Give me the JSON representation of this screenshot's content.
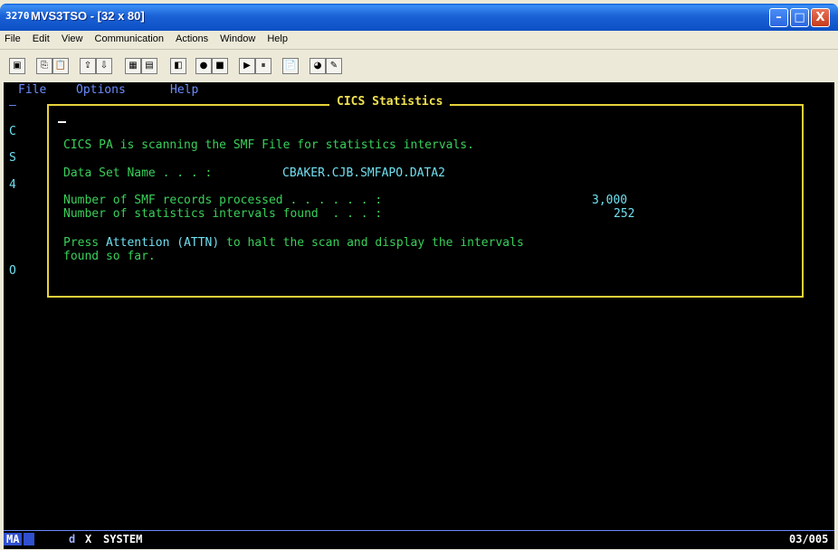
{
  "window": {
    "icon": "3270",
    "title": "MVS3TSO - [32 x 80]",
    "min": "–",
    "max": "□",
    "close": "X"
  },
  "menubar": [
    "File",
    "Edit",
    "View",
    "Communication",
    "Actions",
    "Window",
    "Help"
  ],
  "terminal": {
    "menu": {
      "file": "File",
      "options": "Options",
      "help": "Help"
    },
    "side_letters": [
      "C",
      "S",
      "4",
      "O"
    ],
    "panel_title": "CICS Statistics",
    "line1": "CICS PA is scanning the SMF File for statistics intervals.",
    "dsn_label": "Data Set Name . . . :",
    "dsn_value": "CBAKER.CJB.SMFAPO.DATA2",
    "records_label": "Number of SMF records processed . . . . . . :",
    "records_value": "3,000",
    "intervals_label": "Number of statistics intervals found  . . . :",
    "intervals_value": "252",
    "press_prefix": "Press ",
    "press_attention": "Attention",
    "press_attn": "(ATTN)",
    "press_rest": " to halt the scan and display the intervals",
    "press_line2": "found so far."
  },
  "status": {
    "ma": "MA",
    "session": "d",
    "system_icon": "X",
    "system": "SYSTEM",
    "position": "03/005"
  },
  "colors": {
    "titlebar": "#1b62d6",
    "terminal_bg": "#000000",
    "terminal_green": "#3ad05a",
    "terminal_yellow": "#f0e050",
    "terminal_cyan": "#6fe0f0",
    "terminal_blue": "#6c8cff"
  }
}
